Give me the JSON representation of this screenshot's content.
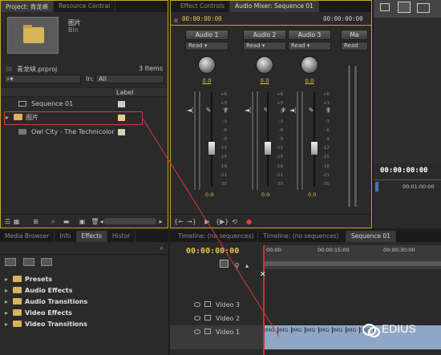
{
  "project_panel": {
    "tabs": [
      "Project: 青龙峡",
      "Resource Central"
    ],
    "bin_name": "图片",
    "bin_type": "Bin",
    "project_file": "青龙峡.prproj",
    "item_count": "3 Items",
    "in_label": "In:",
    "in_value": "All",
    "col_label": "Label",
    "items": [
      {
        "name": "Sequence 01"
      },
      {
        "name": "图片"
      },
      {
        "name": "Owl City - The Technicolor"
      }
    ]
  },
  "mixer_panel": {
    "tabs": [
      "Effect Controls",
      "Audio Mixer: Sequence 01"
    ],
    "timecode_left": "00:00:00:00",
    "timecode_right": "00:00:00:00",
    "channels": [
      {
        "name": "Audio 1",
        "mode": "Read",
        "knob": "0.0",
        "fader": "0.0"
      },
      {
        "name": "Audio 2",
        "mode": "Read",
        "knob": "0.0",
        "fader": "0.0"
      },
      {
        "name": "Audio 3",
        "mode": "Read",
        "knob": "0.0",
        "fader": "0.0"
      },
      {
        "name": "Ma",
        "mode": "Read"
      }
    ],
    "db_ticks": [
      "+6",
      "+3",
      "0",
      "-3",
      "-6",
      "-9",
      "-12",
      "-15",
      "-18",
      "-21",
      "-30",
      "-∞"
    ]
  },
  "program_panel": {
    "timecode": "00:00:00:00",
    "ruler_tc": "00:01:00:00"
  },
  "effects_panel": {
    "tabs": [
      "Media Browser",
      "Info",
      "Effects",
      "Histor"
    ],
    "items": [
      "Presets",
      "Audio Effects",
      "Audio Transitions",
      "Video Effects",
      "Video Transitions"
    ]
  },
  "timeline_panel": {
    "tabs": [
      "Timeline: (no sequences)",
      "Timeline: (no sequences)",
      "Sequence 01"
    ],
    "timecode": "00:00:00:00",
    "ruler_labels": [
      "00:00",
      "00:00:15:00",
      "00:00:30:00"
    ],
    "tracks": [
      "Video 3",
      "Video 2",
      "Video 1"
    ],
    "clip_label": "IMG"
  },
  "watermark": {
    "text": "EDIUS"
  }
}
